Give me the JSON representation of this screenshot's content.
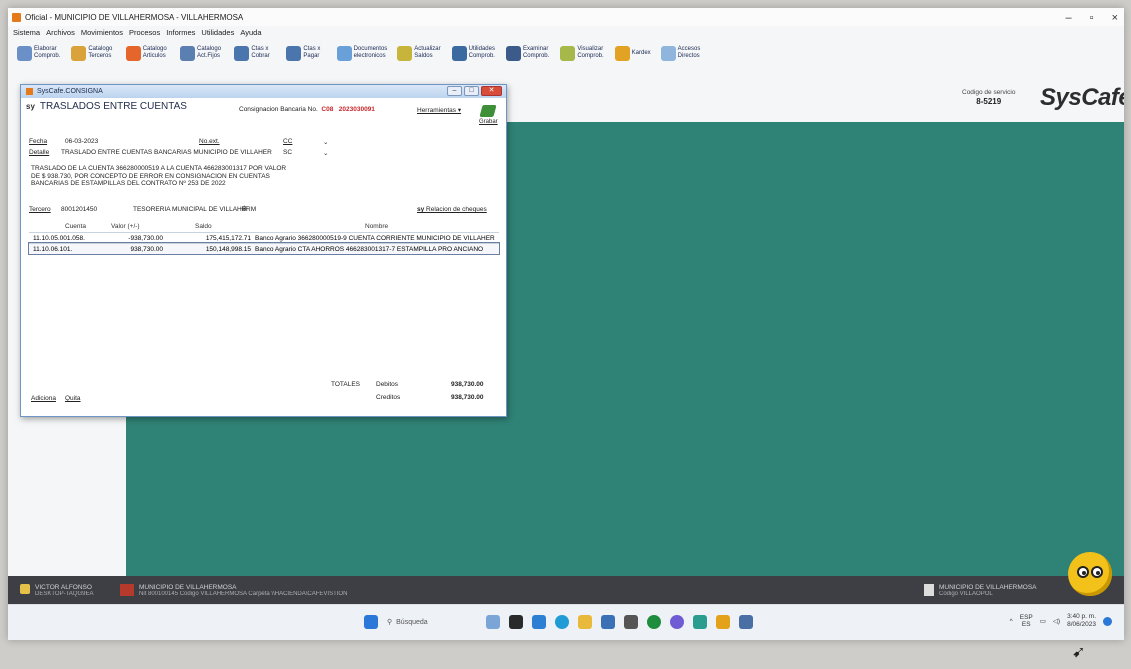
{
  "window": {
    "title": "Oficial - MUNICIPIO DE VILLAHERMOSA - VILLAHERMOSA"
  },
  "menu": [
    "Sistema",
    "Archivos",
    "Movimientos",
    "Procesos",
    "Informes",
    "Utilidades",
    "Ayuda"
  ],
  "toolbar": [
    {
      "label": "Elaborar Comprob.",
      "icon": "document-icon",
      "color": "#6b8fc7"
    },
    {
      "label": "Catalogo Terceros",
      "icon": "people-icon",
      "color": "#d9a23a"
    },
    {
      "label": "Catalogo Articulos",
      "icon": "box-icon",
      "color": "#e4662a"
    },
    {
      "label": "Catalogo Act.Fijos",
      "icon": "wrench-icon",
      "color": "#5b7fb0"
    },
    {
      "label": "Ctas x Cobrar",
      "icon": "hand-coins-icon",
      "color": "#4b76ad"
    },
    {
      "label": "Ctas x Pagar",
      "icon": "hand-pay-icon",
      "color": "#4b76ad"
    },
    {
      "label": "Documentos electronicos",
      "icon": "cloud-docs-icon",
      "color": "#6aa0d8"
    },
    {
      "label": "Actualizar Saldos",
      "icon": "refresh-icon",
      "color": "#c7b43a"
    },
    {
      "label": "Utilidades Comprob.",
      "icon": "tools-icon",
      "color": "#3a6aa0"
    },
    {
      "label": "Examinar Comprob.",
      "icon": "grid-icon",
      "color": "#3c5a8a"
    },
    {
      "label": "Visualizar Comprob.",
      "icon": "eye-icon",
      "color": "#a6b84a"
    },
    {
      "label": "Kardex",
      "icon": "kardex-icon",
      "color": "#e2a224"
    },
    {
      "label": "Accesos Directos",
      "icon": "folder-icon",
      "color": "#8fb5dd"
    }
  ],
  "header": {
    "codigo_label": "Codigo de servicio",
    "codigo_value": "8-5219",
    "logo": "SysCafé"
  },
  "dialog": {
    "window_title": "SysCafe.CONSIGNA",
    "heading": "TRASLADOS ENTRE CUENTAS",
    "sy": "sy",
    "consig_label": "Consignacion Bancaria No.",
    "consig_code": "C08",
    "consig_number": "2023030091",
    "herramientas": "Herramientas",
    "grabar": "Grabar",
    "fecha_label": "Fecha",
    "fecha_value": "06-03-2023",
    "noext_label": "No.ext.",
    "cc_label": "CC",
    "sc_label": "SC",
    "detalle_label": "Detalle",
    "detalle_value": "TRASLADO ENTRE CUENTAS BANCARIAS MUNICIPIO DE VILLAHER",
    "description": "TRASLADO DE LA CUENTA 366280000519 A LA CUENTA 466283001317 POR VALOR DE $ 938.730, POR CONCEPTO DE ERROR EN CONSIGNACION EN CUENTAS BANCARIAS DE ESTAMPILLAS DEL CONTRATO Nº 253 DE 2022",
    "tercero_label": "Tercero",
    "tercero_code": "8001201450",
    "tercero_name": "TESORERIA MUNICIPAL DE VILLAHERM",
    "relacion": "Relacion de cheques",
    "columns": [
      "Cuenta",
      "Valor (+/-)",
      "Saldo",
      "Nombre"
    ],
    "rows": [
      [
        "11.10.05.001.058.",
        "-938,730.00",
        "175,415,172.71",
        "Banco Agrario 366280000519-9 CUENTA CORRIENTE MUNICIPIO DE VILLAHER"
      ],
      [
        "11.10.06.101.",
        "938,730.00",
        "150,148,998.15",
        "Banco Agrario CTA AHORROS 466283001317-7 ESTAMPILLA PRO ANCIANO"
      ]
    ],
    "adiciona": "Adiciona",
    "quita": "Quita",
    "totales": "TOTALES",
    "debitos_label": "Debitos",
    "debitos_value": "938,730.00",
    "creditos_label": "Creditos",
    "creditos_value": "938,730.00"
  },
  "statusbar": {
    "user_name": "VICTOR ALFONSO",
    "user_host": "DESKTOP-TAQG9EA",
    "muni_name": "MUNICIPIO DE VILLAHERMOSA",
    "muni_detail": "Nit 800100145 Codigo VILLAHERMOSA Carpeta \\\\HACIENDA\\CAFEVISTION",
    "right_name": "MUNICIPIO DE VILLAHERMOSA",
    "right_detail": "Codigo VILLAOPOL"
  },
  "taskbar": {
    "search_placeholder": "Búsqueda",
    "lang": "ESP",
    "lang2": "ES",
    "time": "3:40 p. m.",
    "date": "8/06/2023"
  }
}
